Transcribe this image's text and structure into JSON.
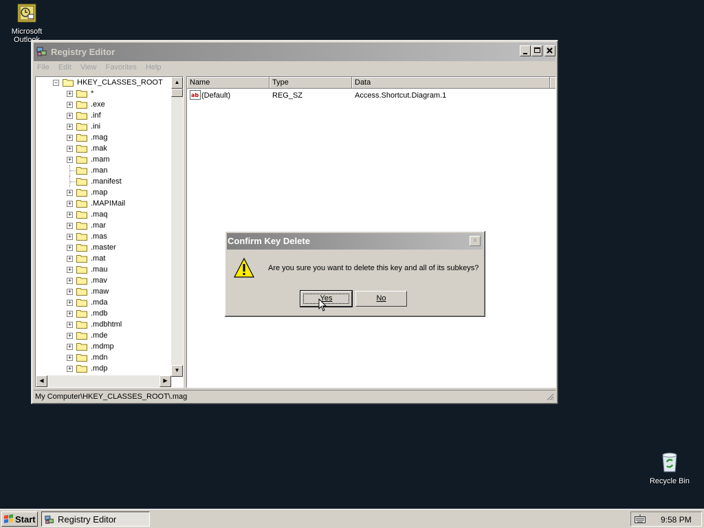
{
  "desktop": {
    "icons": [
      {
        "label_line1": "Microsoft",
        "label_line2": "Outlook",
        "icon": "outlook-icon"
      },
      {
        "label_line1": "Recycle Bin",
        "icon": "recycle-bin-icon"
      }
    ]
  },
  "window": {
    "title": "Registry Editor",
    "menu": [
      "File",
      "Edit",
      "View",
      "Favorites",
      "Help"
    ],
    "tree": {
      "root": "HKEY_CLASSES_ROOT",
      "items": [
        {
          "label": "*",
          "expandable": true
        },
        {
          "label": ".exe",
          "expandable": true
        },
        {
          "label": ".inf",
          "expandable": true
        },
        {
          "label": ".ini",
          "expandable": true
        },
        {
          "label": ".mag",
          "expandable": true,
          "selected": true
        },
        {
          "label": ".mak",
          "expandable": true
        },
        {
          "label": ".mam",
          "expandable": true
        },
        {
          "label": ".man",
          "expandable": false
        },
        {
          "label": ".manifest",
          "expandable": false
        },
        {
          "label": ".map",
          "expandable": true
        },
        {
          "label": ".MAPIMail",
          "expandable": true
        },
        {
          "label": ".maq",
          "expandable": true
        },
        {
          "label": ".mar",
          "expandable": true
        },
        {
          "label": ".mas",
          "expandable": true
        },
        {
          "label": ".master",
          "expandable": true
        },
        {
          "label": ".mat",
          "expandable": true
        },
        {
          "label": ".mau",
          "expandable": true
        },
        {
          "label": ".mav",
          "expandable": true
        },
        {
          "label": ".maw",
          "expandable": true
        },
        {
          "label": ".mda",
          "expandable": true
        },
        {
          "label": ".mdb",
          "expandable": true
        },
        {
          "label": ".mdbhtml",
          "expandable": true
        },
        {
          "label": ".mde",
          "expandable": true
        },
        {
          "label": ".mdmp",
          "expandable": true
        },
        {
          "label": ".mdn",
          "expandable": true
        },
        {
          "label": ".mdp",
          "expandable": true
        }
      ]
    },
    "list": {
      "columns": [
        "Name",
        "Type",
        "Data"
      ],
      "rows": [
        {
          "name": "(Default)",
          "type": "REG_SZ",
          "data": "Access.Shortcut.Diagram.1"
        }
      ]
    },
    "status": "My Computer\\HKEY_CLASSES_ROOT\\.mag"
  },
  "dialog": {
    "title": "Confirm Key Delete",
    "close": "×",
    "message": "Are you sure you want to delete this key and all of its subkeys?",
    "yes_label": "Yes",
    "no_label": "No",
    "icon": "warning-icon"
  },
  "taskbar": {
    "start_label": "Start",
    "task_label": "Registry Editor",
    "clock": "9:58 PM"
  },
  "colors": {
    "desktop": "#101b26",
    "face": "#d4d0c8",
    "inactive_title": "#808080"
  }
}
